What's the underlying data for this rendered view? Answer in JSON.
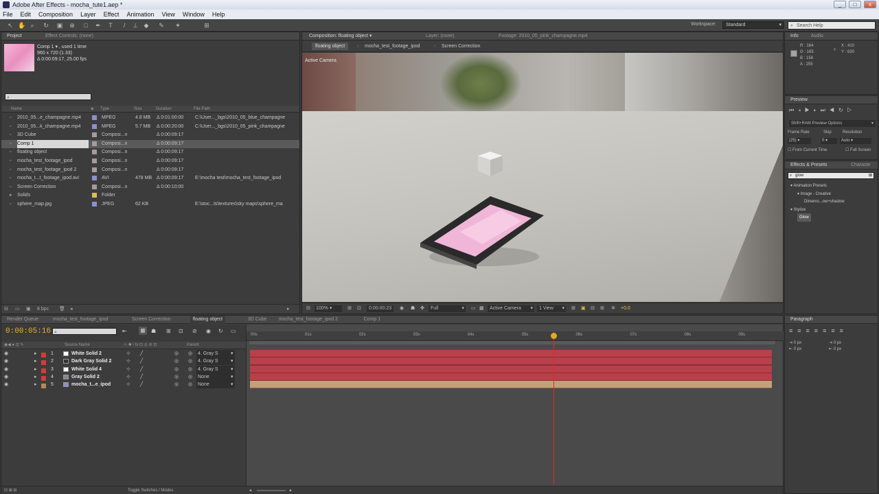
{
  "window": {
    "title": "Adobe After Effects - mocha_tute1.aep *",
    "min": "_",
    "max": "□",
    "close": "x"
  },
  "menu": [
    "File",
    "Edit",
    "Composition",
    "Layer",
    "Effect",
    "Animation",
    "View",
    "Window",
    "Help"
  ],
  "toolbar": {
    "workspace_label": "Workspace:",
    "workspace_value": "Standard",
    "search_placeholder": "Search Help"
  },
  "project": {
    "tab_project": "Project",
    "tab_effects": "Effect Controls: (none)",
    "comp_name": "Comp 1 ▾ , used 1 time",
    "comp_size": "960 x 720 (1.33)",
    "comp_duration": "Δ 0:00:09:17, 25.00 fps",
    "columns": {
      "name": "Name",
      "type": "Type",
      "size": "Size",
      "duration": "Duration",
      "path": "File Path"
    },
    "items": [
      {
        "name": "2010_05...e_champagne.mp4",
        "type": "MPEG",
        "size": "4.8 MB",
        "duration": "Δ 0:01:00:00",
        "path": "C:\\User..._bgs\\2010_05_blue_champagne",
        "color": "#8b8fd0"
      },
      {
        "name": "2010_05...k_champagne.mp4",
        "type": "MPEG",
        "size": "5.7 MB",
        "duration": "Δ 0:00:20:00",
        "path": "C:\\User..._bgs\\2010_05_pink_champagne",
        "color": "#8b8fd0"
      },
      {
        "name": "3D Cube",
        "type": "Composi...n",
        "size": "",
        "duration": "Δ 0:00:09:17",
        "path": "",
        "color": "#a59aa0"
      },
      {
        "name": "Comp 1",
        "type": "Composi...n",
        "size": "",
        "duration": "Δ 0:00:09:17",
        "path": "",
        "color": "#a59aa0"
      },
      {
        "name": "floating object",
        "type": "Composi...n",
        "size": "",
        "duration": "Δ 0:00:09:17",
        "path": "",
        "color": "#a59aa0"
      },
      {
        "name": "mocha_test_footage_ipod",
        "type": "Composi...n",
        "size": "",
        "duration": "Δ 0:00:09:17",
        "path": "",
        "color": "#a59aa0"
      },
      {
        "name": "mocha_test_footage_ipod 2",
        "type": "Composi...n",
        "size": "",
        "duration": "Δ 0:00:09:17",
        "path": "",
        "color": "#a59aa0"
      },
      {
        "name": "mocha_t...t_footage_ipod.avi",
        "type": "AVI",
        "size": "478 MB",
        "duration": "Δ 0:00:09:17",
        "path": "E:\\mocha test\\mocha_test_footage_ipod",
        "color": "#8b8fd0"
      },
      {
        "name": "Screen Correction",
        "type": "Composi...n",
        "size": "",
        "duration": "Δ 0:00:10:00",
        "path": "",
        "color": "#a59aa0"
      },
      {
        "name": "Solids",
        "type": "Folder",
        "size": "",
        "duration": "",
        "path": "",
        "color": "#d8c050"
      },
      {
        "name": "sphere_map.jpg",
        "type": "JPEG",
        "size": "62 KB",
        "duration": "",
        "path": "E:\\stoc...ls\\textures\\sky maps\\sphere_ma",
        "color": "#8b8fd0"
      }
    ],
    "bpc": "8 bpc"
  },
  "composition": {
    "tab_comp": "Composition: floating object",
    "tab_layer": "Layer: (none)",
    "tab_footage": "Footage: 2010_05_pink_champagne.mp4",
    "breadcrumbs": [
      "floating object",
      "mocha_test_footage_ipod",
      "Screen Correction"
    ],
    "camera_label": "Active Camera",
    "zoom": "100%",
    "timecode": "0:00:00:23",
    "resolution": "Full",
    "camera": "Active Camera",
    "view": "1 View",
    "offset": "+0.0"
  },
  "info": {
    "tab_info": "Info",
    "tab_audio": "Audio",
    "r": "R : 164",
    "g": "G : 165",
    "b": "B : 158",
    "a": "A : 255",
    "x": "X : 410",
    "y": "Y : 630"
  },
  "preview": {
    "tab": "Preview",
    "options": "Shift+RAM Preview Options",
    "frame_rate_label": "Frame Rate",
    "skip_label": "Skip",
    "resolution_label": "Resolution",
    "frame_rate": "(25)",
    "skip": "0",
    "resolution": "Auto",
    "from_current": "From Current Time",
    "full_screen": "Full Screen"
  },
  "effects": {
    "tab": "Effects & Presets",
    "tab2": "Characte",
    "search": "glow",
    "tree": [
      {
        "label": "▾ Animation Presets",
        "indent": 0
      },
      {
        "label": "▾ Image - Creative",
        "indent": 1
      },
      {
        "label": "Dimensi...ow+shadow",
        "indent": 2
      },
      {
        "label": "▾ Stylize",
        "indent": 0
      },
      {
        "label": "Glow",
        "indent": 1
      }
    ]
  },
  "timeline": {
    "tabs": [
      "Render Queue",
      "mocha_test_footage_ipod",
      "Screen Correction",
      "floating object",
      "3D Cube",
      "mocha_test_footage_ipod 2",
      "Comp 1"
    ],
    "current_time": "0:00:05:16",
    "col_source": "Source Name",
    "col_parent": "Parent",
    "ruler": [
      "00s",
      "01s",
      "02s",
      "03s",
      "04s",
      "05s",
      "06s",
      "07s",
      "08s",
      "09s"
    ],
    "playhead_seconds": 5.6,
    "duration_seconds": 9.68,
    "layers": [
      {
        "num": "1",
        "name": "White Solid 2",
        "parent": "4. Gray S",
        "label": "#d23b3b",
        "swatch": "#ffffff"
      },
      {
        "num": "2",
        "name": "Dark Gray Solid 2",
        "parent": "4. Gray S",
        "label": "#d23b3b",
        "swatch": "#333333"
      },
      {
        "num": "3",
        "name": "White Solid 4",
        "parent": "4. Gray S",
        "label": "#d23b3b",
        "swatch": "#ffffff"
      },
      {
        "num": "4",
        "name": "Gray Solid 2",
        "parent": "None",
        "label": "#d23b3b",
        "swatch": "#888888"
      },
      {
        "num": "5",
        "name": "mocha_t...e_ipod",
        "parent": "None",
        "label": "#b08a5a",
        "swatch": "#8b8fd0"
      }
    ],
    "toggle": "Toggle Switches / Modes"
  },
  "paragraph": {
    "tab": "Paragraph",
    "px1": "0 px",
    "px2": "0 px",
    "px3": "0 px",
    "px4": "0 px"
  }
}
